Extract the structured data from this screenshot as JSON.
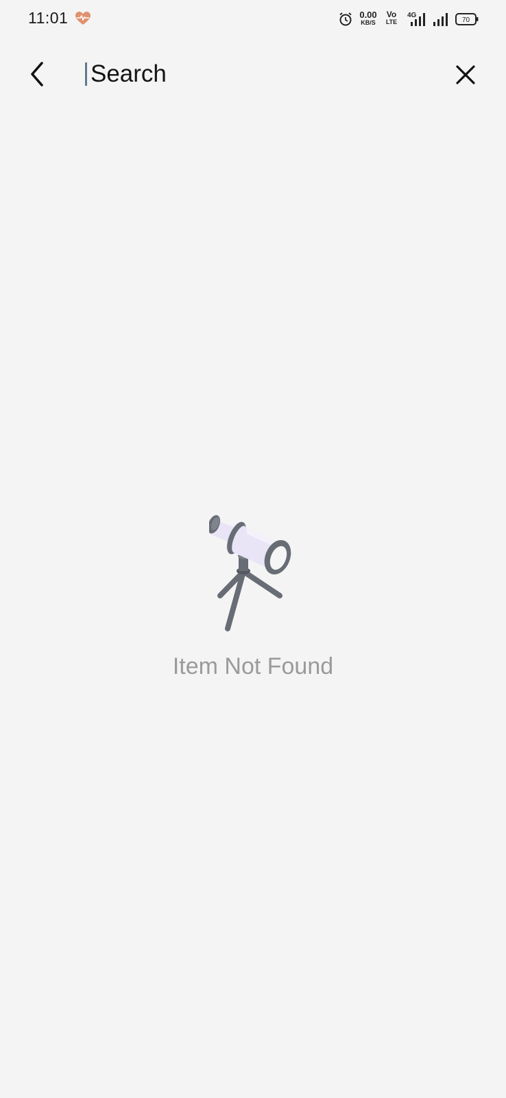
{
  "status_bar": {
    "time": "11:01",
    "network_speed_value": "0.00",
    "network_speed_unit": "KB/S",
    "volte_top": "Vo",
    "volte_bottom": "LTE",
    "network_type": "4G",
    "battery_level": "70",
    "icons": [
      "health-heart-icon",
      "alarm-icon",
      "signal-icon",
      "signal-icon",
      "battery-icon"
    ],
    "health_icon_color": "#e0916f"
  },
  "search": {
    "placeholder": "Search",
    "caret_color": "#5e7a92"
  },
  "empty_state": {
    "message": "Item Not Found",
    "icon": "telescope-icon",
    "tube_color": "#e9e4f6",
    "metal_color": "#676c75"
  }
}
